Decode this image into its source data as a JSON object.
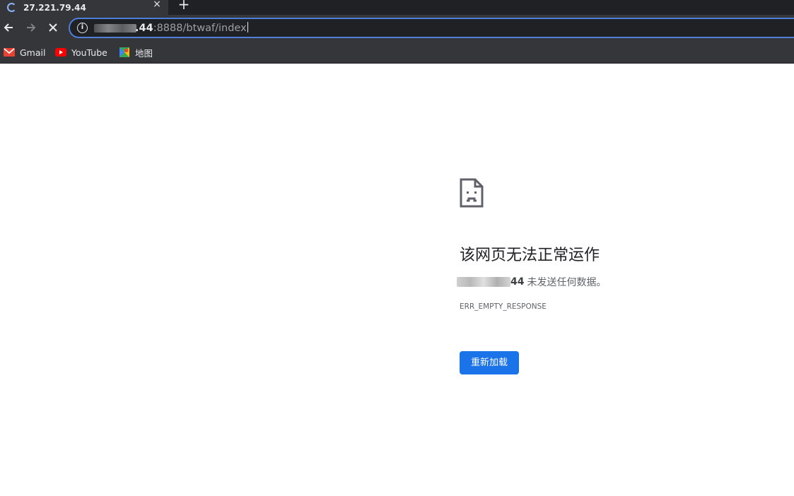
{
  "tab": {
    "title": "27.221.79.44",
    "close_icon": "×",
    "new_tab_icon": "+"
  },
  "toolbar": {
    "url_host_visible": ".44",
    "url_path": ":8888/btwaf/index",
    "info_icon": "i"
  },
  "bookmarks": [
    {
      "label": "Gmail",
      "icon": "gmail-icon"
    },
    {
      "label": "YouTube",
      "icon": "youtube-icon"
    },
    {
      "label": "地图",
      "icon": "maps-icon"
    }
  ],
  "error": {
    "icon": "sad-page-icon",
    "title": "该网页无法正常运作",
    "host_visible": "44",
    "message": "未发送任何数据。",
    "code": "ERR_EMPTY_RESPONSE",
    "reload_label": "重新加载"
  },
  "colors": {
    "accent": "#1a73e8",
    "toolbar_bg": "#35363a",
    "tabstrip_bg": "#202124",
    "omnibox_border": "#4f7ed9"
  }
}
